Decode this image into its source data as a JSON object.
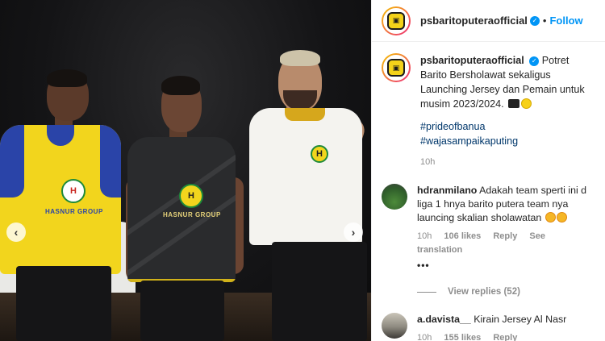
{
  "post": {
    "username": "psbaritoputeraofficial",
    "separator": "•",
    "follow_label": "Follow",
    "caption_text": "Potret Barito Bersholawat sekaligus Launching Jersey dan Pemain untuk musim 2023/2024.",
    "hashtags": [
      "#prideofbanua",
      "#wajasampaikaputing"
    ],
    "time": "10h"
  },
  "photo": {
    "sponsor_text": "HASNUR GROUP",
    "crest_letter": "H",
    "prev_icon": "‹",
    "next_icon": "›"
  },
  "comments": [
    {
      "username": "hdranmilano",
      "text": "Adakah team sperti ini d liga 1 hnya barito putera team nya launcing skalian sholawatan",
      "time": "10h",
      "likes": "106 likes",
      "reply_label": "Reply",
      "translation_label": "See translation",
      "more_label": "•••",
      "view_replies": "View replies (52)"
    },
    {
      "username": "a.davista__",
      "text": "Kirain Jersey Al Nasr",
      "time": "10h",
      "likes": "155 likes",
      "reply_label": "Reply"
    }
  ],
  "colors": {
    "accent": "#0095f6",
    "home_jersey": "#f2d51d",
    "home_jersey_trim": "#2a44a8",
    "dark_jersey": "#2a2b2d",
    "white_jersey": "#f4f3ef"
  }
}
